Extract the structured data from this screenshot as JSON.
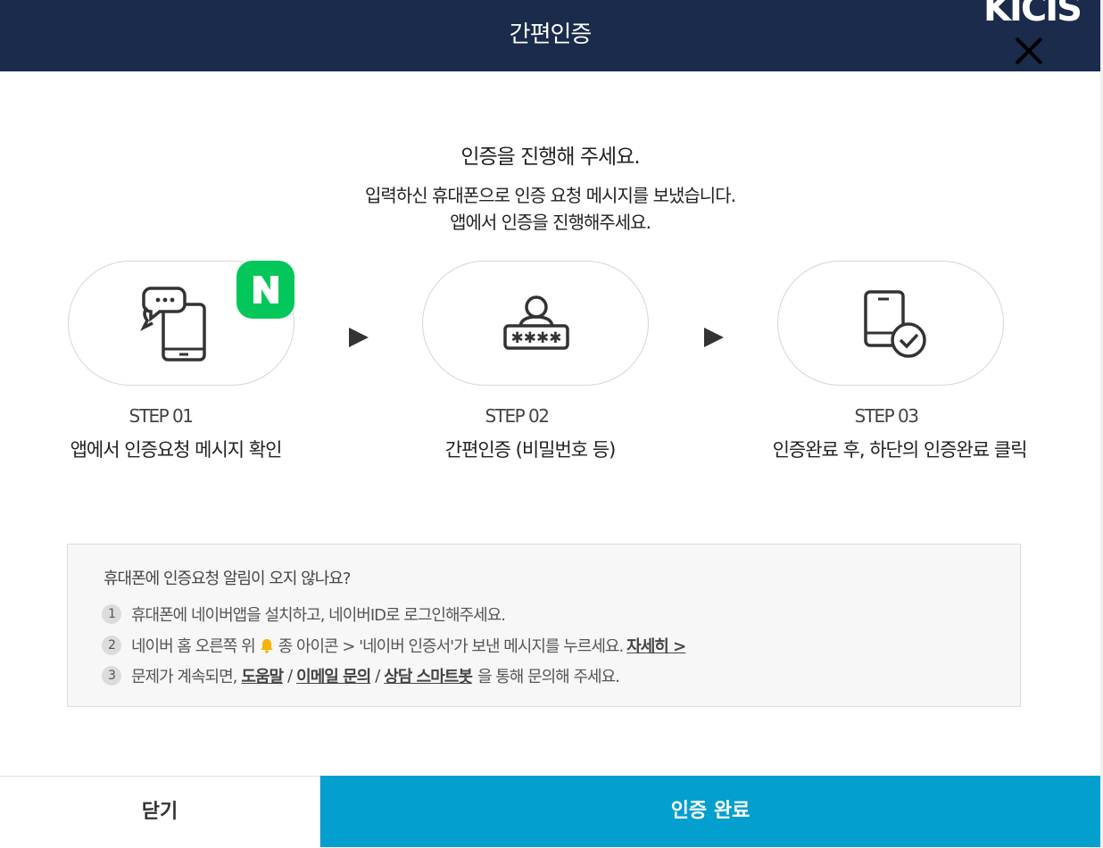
{
  "header": {
    "title": "간편인증",
    "logo_text": "KICIS",
    "background": "#1a2b4c"
  },
  "intro": {
    "title": "인증을 진행해 주세요.",
    "desc_line1": "입력하신 휴대폰으로 인증 요청 메시지를 보냈습니다.",
    "desc_line2": "앱에서 인증을 진행해주세요."
  },
  "steps": [
    {
      "number": "STEP 01",
      "desc": "앱에서 인증요청 메시지 확인",
      "icon": "phone-chat-icon"
    },
    {
      "number": "STEP 02",
      "desc": "간편인증 (비밀번호 등)",
      "icon": "user-password-icon"
    },
    {
      "number": "STEP 03",
      "desc": "인증완료 후, 하단의 인증완료 클릭",
      "icon": "phone-check-icon"
    }
  ],
  "naver_badge": {
    "letter": "N",
    "color": "#03c75a"
  },
  "help": {
    "title": "휴대폰에 인증요청 알림이 오지 않나요?",
    "items": [
      {
        "num": "1",
        "text": "휴대폰에 네이버앱을 설치하고, 네이버ID로 로그인해주세요."
      },
      {
        "num": "2",
        "text_before": "네이버 홈 오른쪽 위",
        "text_after": "종 아이콘 > '네이버 인증서'가 보낸 메시지를 누르세요.",
        "link": "자세히 >"
      },
      {
        "num": "3",
        "text_before": "문제가 계속되면,",
        "link1": "도움말",
        "link2": "이메일 문의",
        "link3": "상담 스마트봇",
        "text_after": "을 통해 문의해 주세요.",
        "sep": "/"
      }
    ]
  },
  "footer": {
    "close_label": "닫기",
    "done_label": "인증 완료",
    "done_color": "#039fcf"
  }
}
